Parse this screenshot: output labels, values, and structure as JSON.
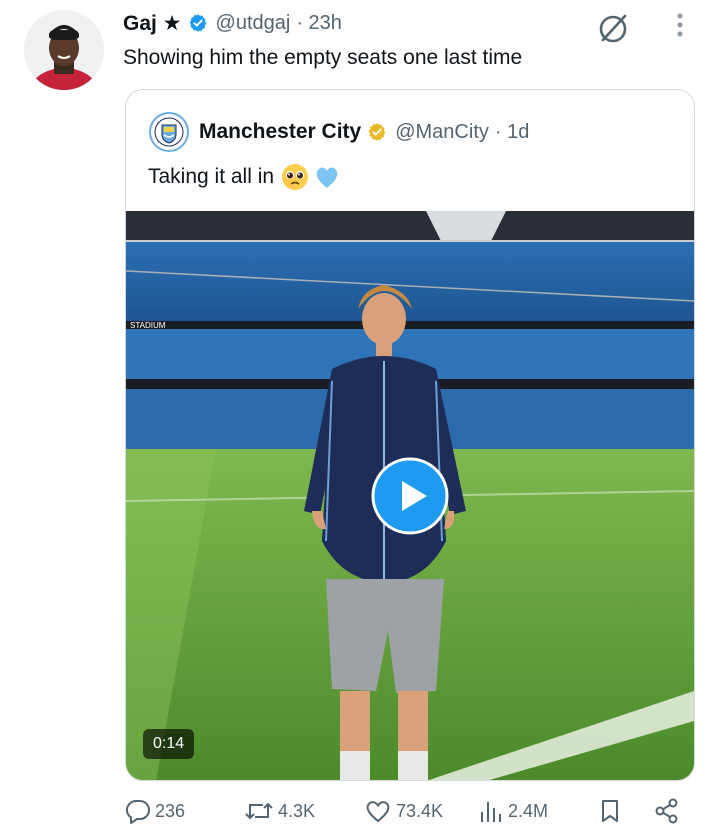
{
  "tweet": {
    "author_name": "Gaj ★",
    "handle": "@utdgaj",
    "time": "· 23h",
    "text": "Showing him the empty seats one last time"
  },
  "quote": {
    "author_name": "Manchester City",
    "handle": "@ManCity",
    "time": "· 1d",
    "text": "Taking it all in",
    "emojis": [
      "pleading-face",
      "light-blue-heart"
    ],
    "video": {
      "duration": "0:14",
      "stadium_sign": "STADIUM"
    }
  },
  "actions": {
    "replies": "236",
    "reposts": "4.3K",
    "likes": "73.4K",
    "views": "2.4M"
  },
  "icons": {
    "verified": "verified-badge-icon",
    "affiliate_gold": "gold-verified-badge-icon",
    "grok": "grok-icon",
    "more": "more-vertical-icon",
    "reply": "reply-icon",
    "repost": "repost-icon",
    "like": "heart-icon",
    "views": "views-icon",
    "bookmark": "bookmark-icon",
    "share": "share-icon"
  },
  "colors": {
    "brand_blue": "#1d9bf0",
    "text": "#0f1419",
    "secondary": "#536471",
    "gold_badge": "#e8b829",
    "border": "#cfd9de"
  }
}
